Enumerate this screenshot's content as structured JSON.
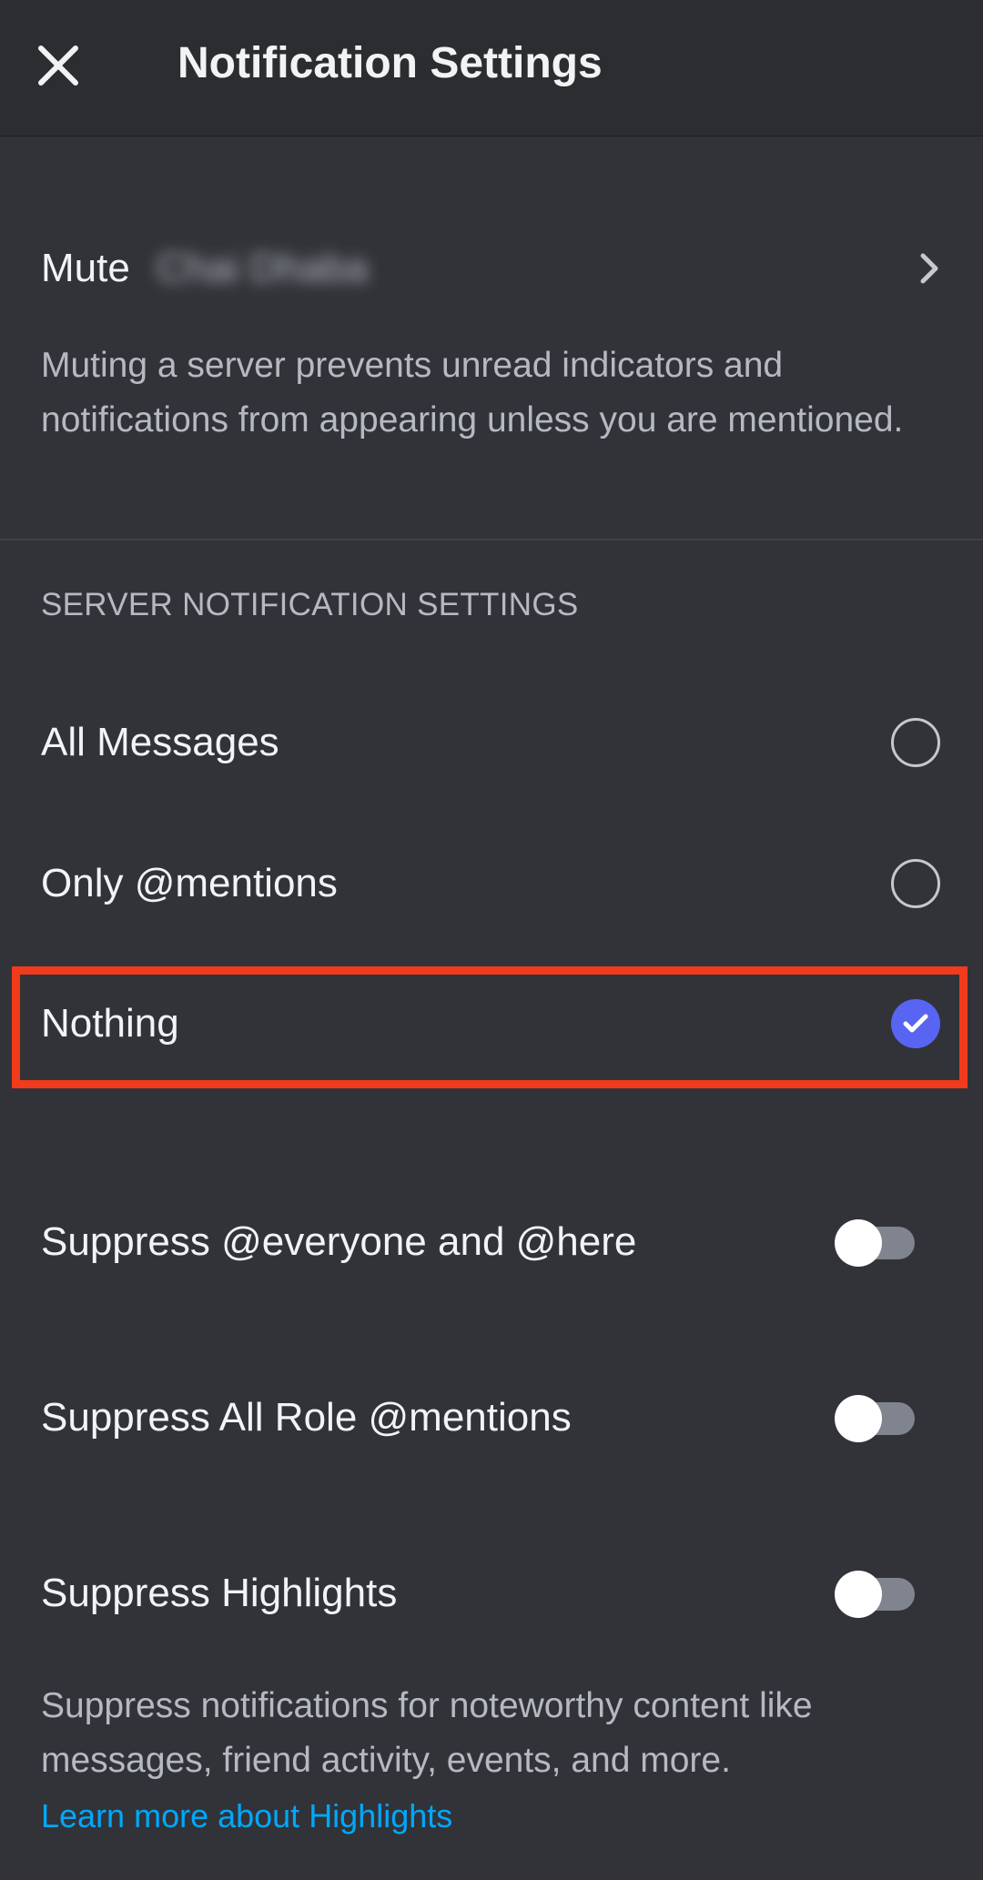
{
  "header": {
    "title": "Notification Settings",
    "close_icon": "close-icon"
  },
  "mute": {
    "label": "Mute",
    "server_name": "Chai Dhaba",
    "chevron_icon": "chevron-right-icon",
    "description": "Muting a server prevents unread indicators and notifications from appearing unless you are mentioned."
  },
  "server_notifications": {
    "section_title": "SERVER NOTIFICATION SETTINGS",
    "selected": "Nothing",
    "options": [
      {
        "label": "All Messages",
        "checked": false
      },
      {
        "label": "Only @mentions",
        "checked": false
      },
      {
        "label": "Nothing",
        "checked": true
      }
    ]
  },
  "toggles": [
    {
      "label": "Suppress @everyone and @here",
      "enabled": false
    },
    {
      "label": "Suppress All Role @mentions",
      "enabled": false
    },
    {
      "label": "Suppress Highlights",
      "enabled": false
    }
  ],
  "highlights": {
    "description": "Suppress notifications for noteworthy content like messages, friend activity, events, and more.",
    "learn_more_link": "Learn more about Highlights"
  },
  "colors": {
    "background": "#313338",
    "header_background": "#2b2d31",
    "accent": "#5865f2",
    "link": "#00a8fc",
    "highlight_annotation": "#f23a1c"
  }
}
